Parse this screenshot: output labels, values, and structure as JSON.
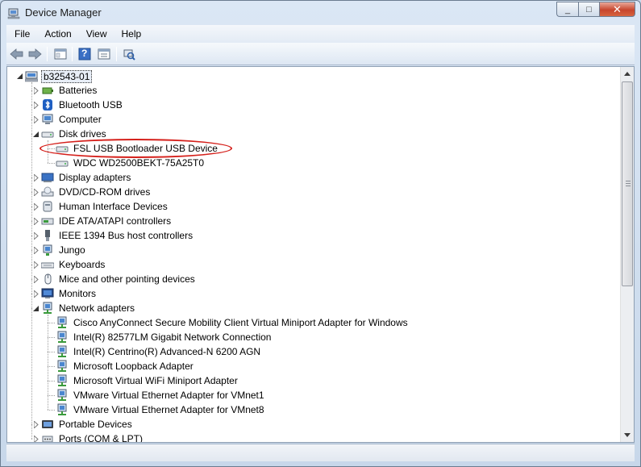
{
  "window": {
    "title": "Device Manager",
    "close_glyph": "✕",
    "max_glyph": "□",
    "min_glyph": "_"
  },
  "menubar": {
    "items": [
      "File",
      "Action",
      "View",
      "Help"
    ]
  },
  "toolbar": {
    "help_glyph": "?"
  },
  "tree": {
    "root": "b32543-01",
    "nodes": [
      {
        "label": "Batteries",
        "icon": "battery-icon"
      },
      {
        "label": "Bluetooth USB",
        "icon": "bluetooth-icon"
      },
      {
        "label": "Computer",
        "icon": "computer-icon"
      },
      {
        "label": "Disk drives",
        "icon": "disk-drive-icon",
        "children": [
          "FSL  USB  Bootloader USB Device",
          "WDC WD2500BEKT-75A25T0"
        ]
      },
      {
        "label": "Display adapters",
        "icon": "display-adapter-icon"
      },
      {
        "label": "DVD/CD-ROM drives",
        "icon": "dvd-drive-icon"
      },
      {
        "label": "Human Interface Devices",
        "icon": "hid-icon"
      },
      {
        "label": "IDE ATA/ATAPI controllers",
        "icon": "ide-controller-icon"
      },
      {
        "label": "IEEE 1394 Bus host controllers",
        "icon": "ieee1394-icon"
      },
      {
        "label": "Jungo",
        "icon": "network-device-icon"
      },
      {
        "label": "Keyboards",
        "icon": "keyboard-icon"
      },
      {
        "label": "Mice and other pointing devices",
        "icon": "mouse-icon"
      },
      {
        "label": "Monitors",
        "icon": "monitor-icon"
      },
      {
        "label": "Network adapters",
        "icon": "network-adapter-icon",
        "children": [
          "Cisco AnyConnect Secure Mobility Client Virtual Miniport Adapter for Windows",
          "Intel(R) 82577LM Gigabit Network Connection",
          "Intel(R) Centrino(R) Advanced-N 6200 AGN",
          "Microsoft Loopback Adapter",
          "Microsoft Virtual WiFi Miniport Adapter",
          "VMware Virtual Ethernet Adapter for VMnet1",
          "VMware Virtual Ethernet Adapter for VMnet8"
        ]
      },
      {
        "label": "Portable Devices",
        "icon": "portable-device-icon"
      },
      {
        "label": "Ports (COM & LPT)",
        "icon": "port-icon"
      }
    ]
  },
  "colors": {
    "highlight_ring": "#d5201b",
    "title_gradient_top": "#dbe7f5"
  }
}
